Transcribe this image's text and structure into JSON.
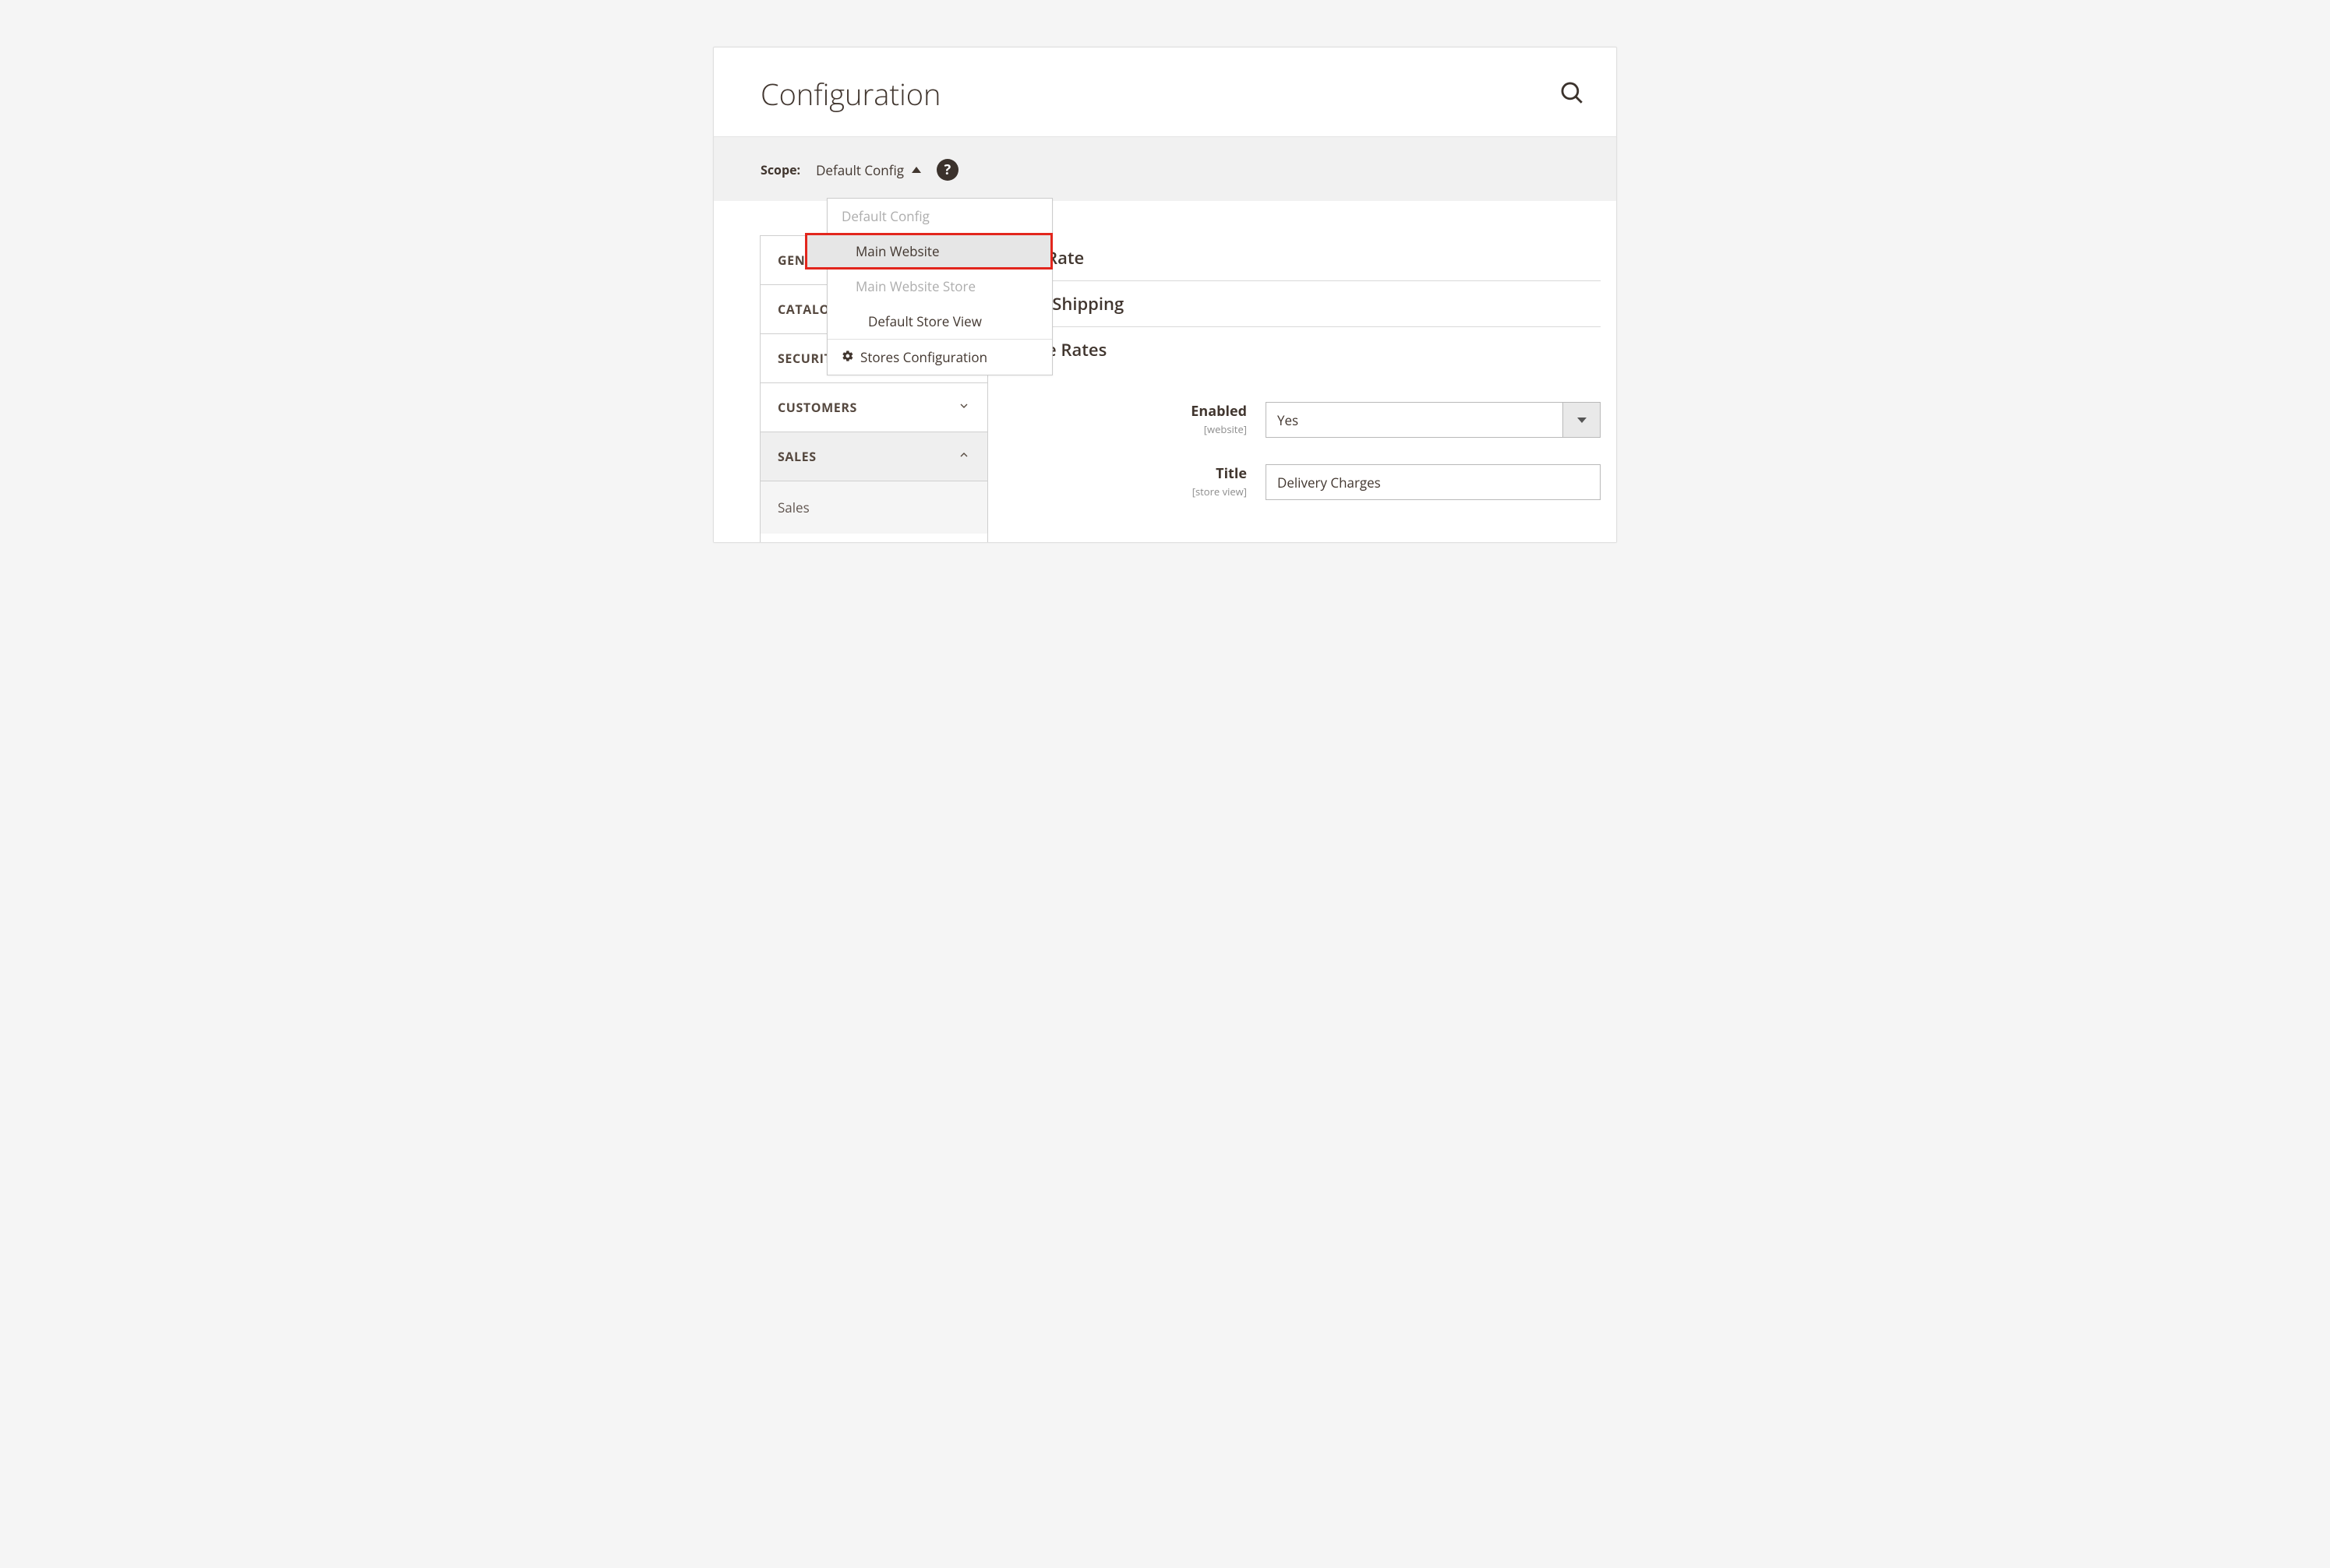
{
  "header": {
    "title": "Configuration"
  },
  "scope": {
    "label": "Scope:",
    "selected": "Default Config",
    "dropdown": {
      "default_config": "Default Config",
      "main_website": "Main Website",
      "main_website_store": "Main Website Store",
      "default_store_view": "Default Store View",
      "stores_configuration": "Stores Configuration"
    }
  },
  "sidebar": {
    "items": [
      {
        "label": "GENERAL",
        "expanded": false
      },
      {
        "label": "CATALOG",
        "expanded": false
      },
      {
        "label": "SECURITY",
        "expanded": false
      },
      {
        "label": "CUSTOMERS",
        "expanded": false
      },
      {
        "label": "SALES",
        "expanded": true
      }
    ],
    "sales_sub": "Sales"
  },
  "sections": {
    "flat_rate": "Flat Rate",
    "free_shipping": "Free Shipping",
    "table_rates": "Table Rates"
  },
  "form": {
    "enabled": {
      "label": "Enabled",
      "scope": "[website]",
      "value": "Yes"
    },
    "title": {
      "label": "Title",
      "scope": "[store view]",
      "value": "Delivery Charges"
    }
  }
}
